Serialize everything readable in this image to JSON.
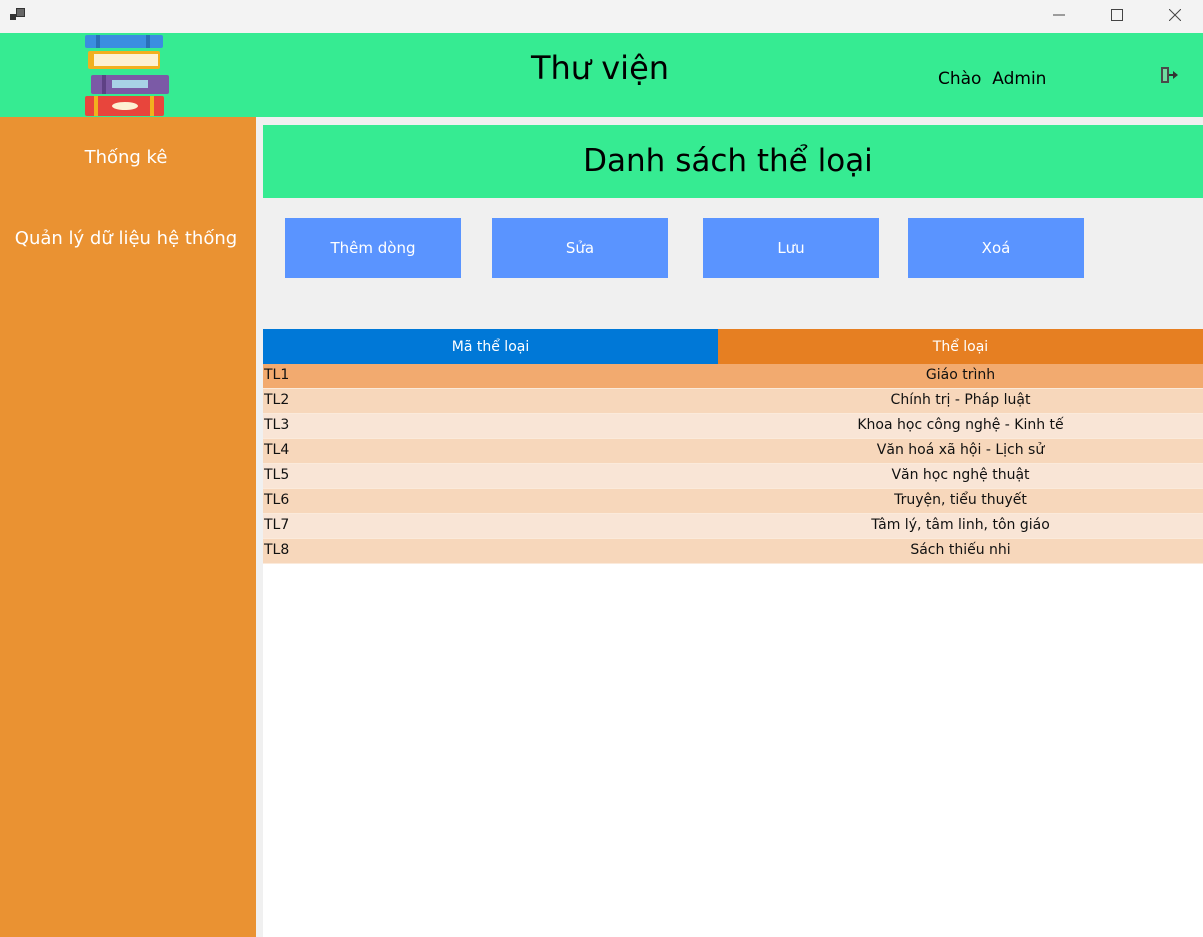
{
  "window": {
    "app_icon": "app-window-icon",
    "controls": [
      "minimize-icon",
      "maximize-icon",
      "close-icon"
    ]
  },
  "header": {
    "title": "Thư viện",
    "greeting": "Chào  Admin",
    "logo": "book-stack-logo",
    "logout_icon": "logout-icon"
  },
  "sidebar": {
    "items": [
      {
        "label": "Thống kê"
      },
      {
        "label": "Quản lý dữ liệu hệ thống"
      }
    ]
  },
  "main": {
    "title": "Danh sách thể loại",
    "buttons": {
      "add": "Thêm dòng",
      "edit": "Sửa",
      "save": "Lưu",
      "delete": "Xoá"
    },
    "table": {
      "columns": [
        "Mã thể loại",
        "Thể loại"
      ],
      "rows": [
        {
          "id": "TL1",
          "name": "Giáo trình",
          "selected": true
        },
        {
          "id": "TL2",
          "name": "Chính trị - Pháp luật"
        },
        {
          "id": "TL3",
          "name": "Khoa học công nghệ - Kinh tế"
        },
        {
          "id": "TL4",
          "name": "Văn hoá xã hội - Lịch sử"
        },
        {
          "id": "TL5",
          "name": "Văn học nghệ thuật"
        },
        {
          "id": "TL6",
          "name": "Truyện, tiểu thuyết"
        },
        {
          "id": "TL7",
          "name": "Tâm lý, tâm linh, tôn giáo"
        },
        {
          "id": "TL8",
          "name": "Sách thiếu nhi"
        }
      ]
    }
  },
  "colors": {
    "header_green": "#36eb92",
    "sidebar_orange": "#ea9232",
    "button_blue": "#5a94ff",
    "column_blue": "#0078d7",
    "column_orange": "#e67f22"
  }
}
